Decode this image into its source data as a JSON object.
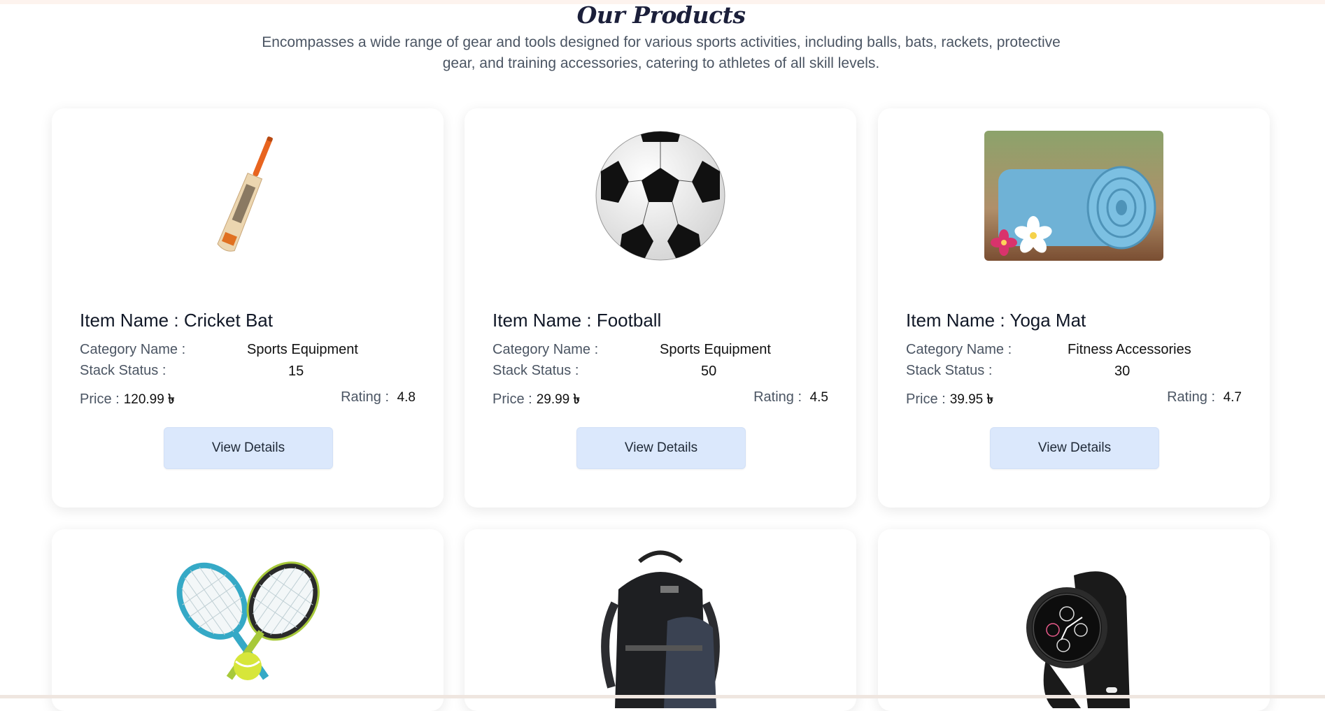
{
  "header": {
    "title": "Our Products",
    "subtitle": "Encompasses a wide range of gear and tools designed for various sports activities, including balls, bats, rackets, protective gear, and training accessories, catering to athletes of all skill levels."
  },
  "labels": {
    "item_name": "Item Name :",
    "category": "Category Name :",
    "stock": "Stack Status :",
    "price": "Price :",
    "rating": "Rating :",
    "button": "View Details",
    "currency": "৳"
  },
  "products": [
    {
      "name": "Cricket Bat",
      "category": "Sports Equipment",
      "stock": "15",
      "price": "120.99",
      "rating": "4.8",
      "image": "cricket-bat"
    },
    {
      "name": "Football",
      "category": "Sports Equipment",
      "stock": "50",
      "price": "29.99",
      "rating": "4.5",
      "image": "football"
    },
    {
      "name": "Yoga Mat",
      "category": "Fitness Accessories",
      "stock": "30",
      "price": "39.95",
      "rating": "4.7",
      "image": "yoga-mat"
    },
    {
      "image": "tennis-rackets"
    },
    {
      "image": "backpack"
    },
    {
      "image": "smartwatch"
    }
  ]
}
